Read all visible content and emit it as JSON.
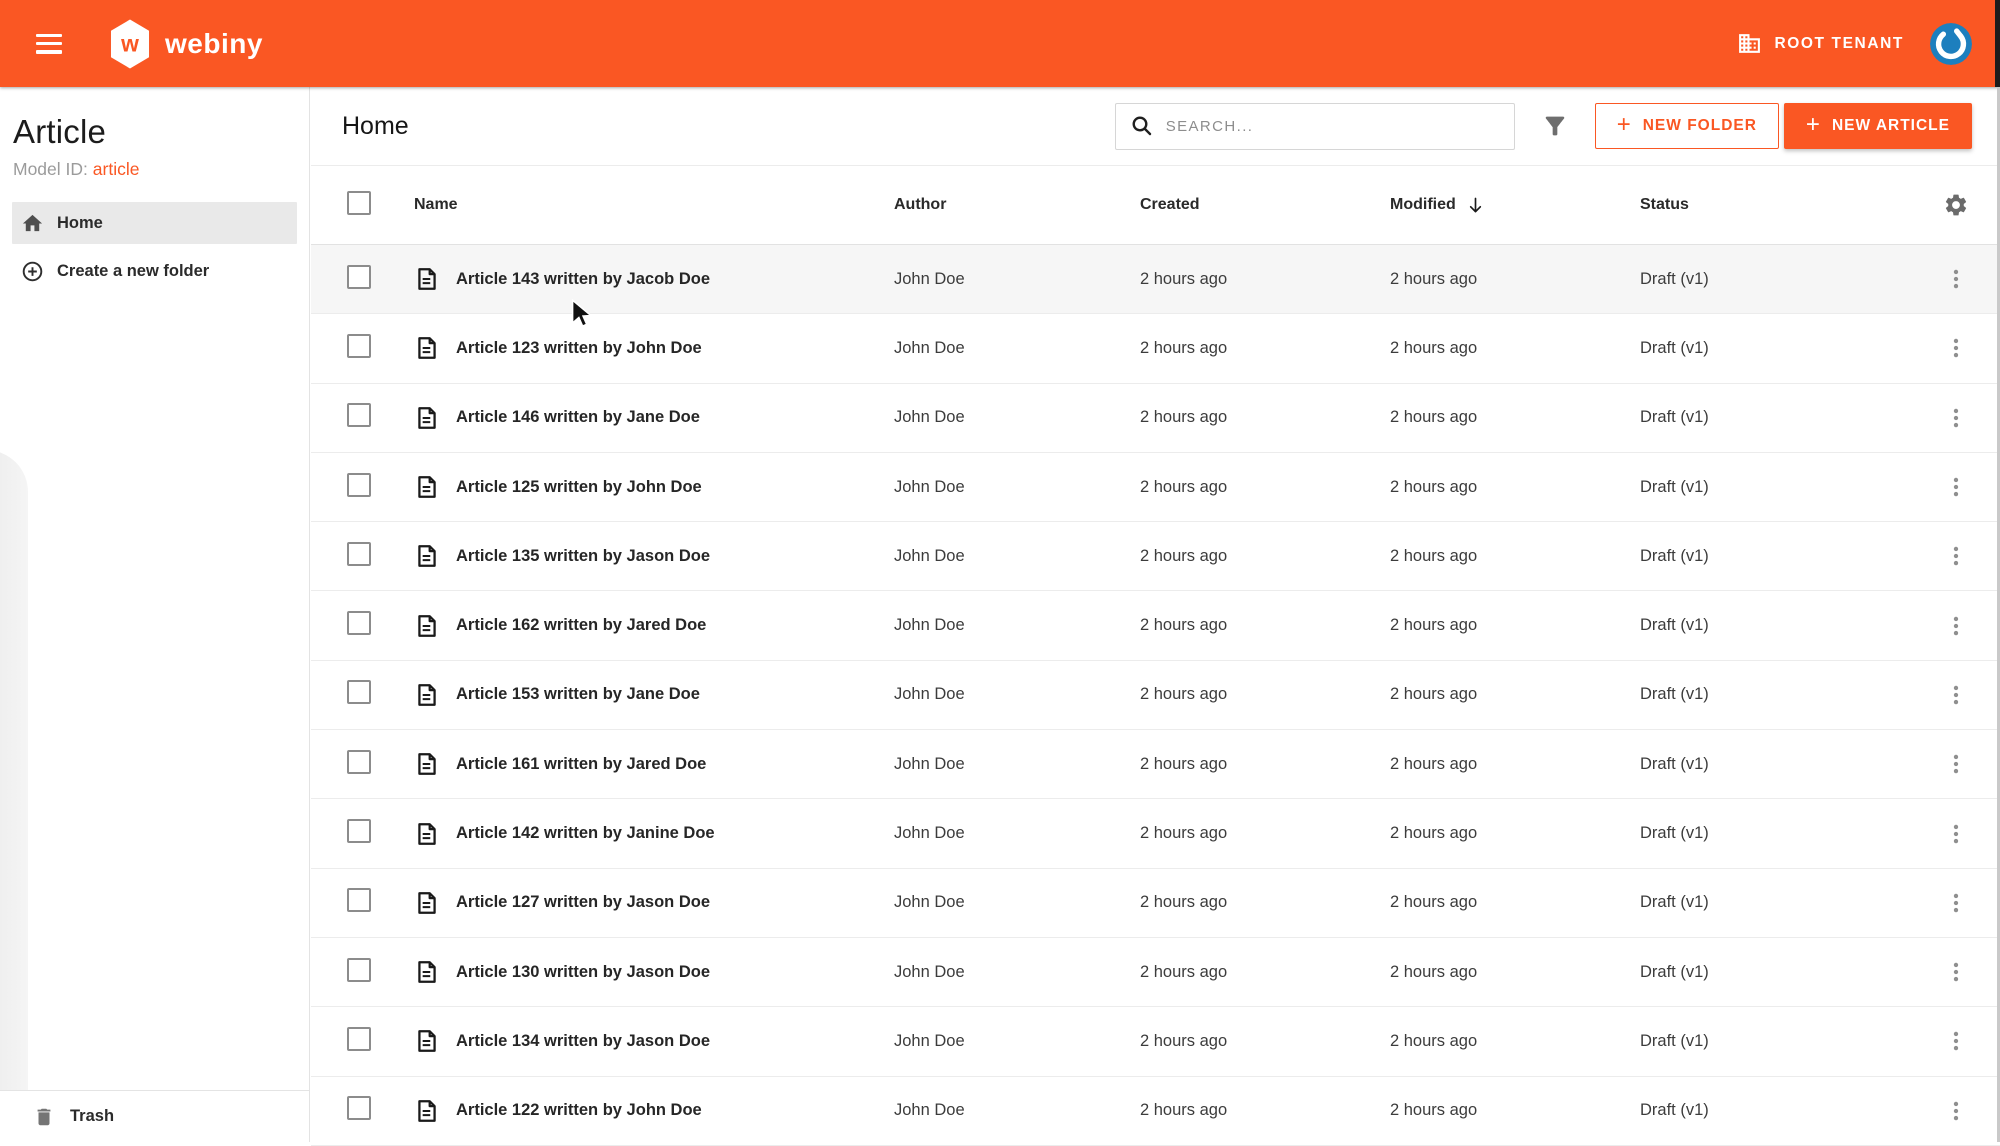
{
  "topbar": {
    "brand": "webiny",
    "tenant_label": "ROOT TENANT"
  },
  "sidebar": {
    "title": "Article",
    "model_id_label": "Model ID:",
    "model_id_value": "article",
    "items": [
      {
        "label": "Home",
        "selected": true
      },
      {
        "label": "Create a new folder",
        "selected": false
      }
    ],
    "trash_label": "Trash"
  },
  "toolbar": {
    "title": "Home",
    "search_placeholder": "SEARCH...",
    "new_folder_label": "NEW FOLDER",
    "new_article_label": "NEW ARTICLE"
  },
  "table": {
    "columns": {
      "name": "Name",
      "author": "Author",
      "created": "Created",
      "modified": "Modified",
      "status": "Status"
    },
    "sort": {
      "column": "Modified",
      "direction": "desc"
    },
    "rows": [
      {
        "name": "Article 143 written by Jacob Doe",
        "author": "John Doe",
        "created": "2 hours ago",
        "modified": "2 hours ago",
        "status": "Draft (v1)",
        "highlighted": true
      },
      {
        "name": "Article 123 written by John Doe",
        "author": "John Doe",
        "created": "2 hours ago",
        "modified": "2 hours ago",
        "status": "Draft (v1)",
        "highlighted": false
      },
      {
        "name": "Article 146 written by Jane Doe",
        "author": "John Doe",
        "created": "2 hours ago",
        "modified": "2 hours ago",
        "status": "Draft (v1)",
        "highlighted": false
      },
      {
        "name": "Article 125 written by John Doe",
        "author": "John Doe",
        "created": "2 hours ago",
        "modified": "2 hours ago",
        "status": "Draft (v1)",
        "highlighted": false
      },
      {
        "name": "Article 135 written by Jason Doe",
        "author": "John Doe",
        "created": "2 hours ago",
        "modified": "2 hours ago",
        "status": "Draft (v1)",
        "highlighted": false
      },
      {
        "name": "Article 162 written by Jared Doe",
        "author": "John Doe",
        "created": "2 hours ago",
        "modified": "2 hours ago",
        "status": "Draft (v1)",
        "highlighted": false
      },
      {
        "name": "Article 153 written by Jane Doe",
        "author": "John Doe",
        "created": "2 hours ago",
        "modified": "2 hours ago",
        "status": "Draft (v1)",
        "highlighted": false
      },
      {
        "name": "Article 161 written by Jared Doe",
        "author": "John Doe",
        "created": "2 hours ago",
        "modified": "2 hours ago",
        "status": "Draft (v1)",
        "highlighted": false
      },
      {
        "name": "Article 142 written by Janine Doe",
        "author": "John Doe",
        "created": "2 hours ago",
        "modified": "2 hours ago",
        "status": "Draft (v1)",
        "highlighted": false
      },
      {
        "name": "Article 127 written by Jason Doe",
        "author": "John Doe",
        "created": "2 hours ago",
        "modified": "2 hours ago",
        "status": "Draft (v1)",
        "highlighted": false
      },
      {
        "name": "Article 130 written by Jason Doe",
        "author": "John Doe",
        "created": "2 hours ago",
        "modified": "2 hours ago",
        "status": "Draft (v1)",
        "highlighted": false
      },
      {
        "name": "Article 134 written by Jason Doe",
        "author": "John Doe",
        "created": "2 hours ago",
        "modified": "2 hours ago",
        "status": "Draft (v1)",
        "highlighted": false
      },
      {
        "name": "Article 122 written by John Doe",
        "author": "John Doe",
        "created": "2 hours ago",
        "modified": "2 hours ago",
        "status": "Draft (v1)",
        "highlighted": false
      }
    ]
  },
  "icons": {
    "menu": "hamburger-icon",
    "logo": "webiny-hexagon-logo",
    "tenant": "building-icon",
    "avatar": "gravatar-icon",
    "home": "home-icon",
    "create_folder": "plus-circle-icon",
    "trash": "trash-icon",
    "search": "search-icon",
    "filter": "filter-funnel-icon",
    "sort": "arrow-down-icon",
    "settings": "gear-icon",
    "row_file": "article-file-icon",
    "row_menu": "kebab-menu-icon"
  },
  "colors": {
    "accent": "#fa5723",
    "avatar_blue": "#1d7fbe",
    "selected_item_bg": "#e9e9e9",
    "row_highlight": "#f6f6f6",
    "divider": "#ececec"
  }
}
